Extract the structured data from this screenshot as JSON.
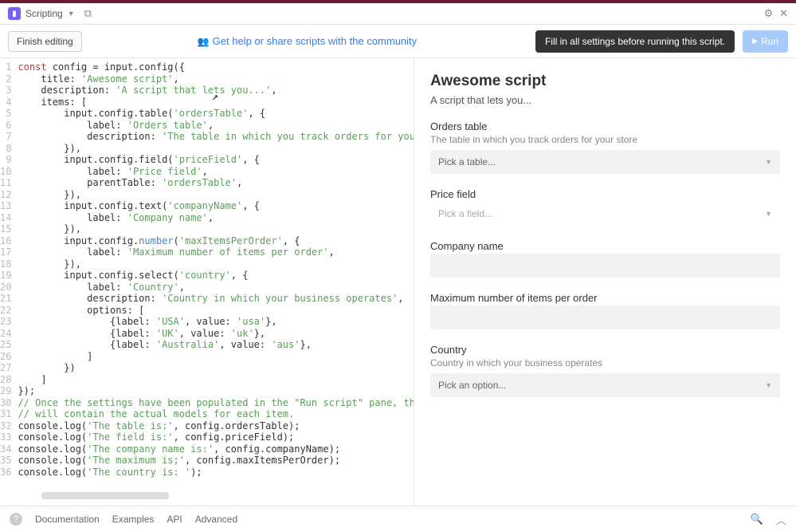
{
  "topbar": {
    "app_title": "Scripting"
  },
  "toolbar": {
    "finish_label": "Finish editing",
    "help_label": "Get help or share scripts with the community",
    "toast_text": "Fill in all settings before running this script.",
    "run_label": "Run"
  },
  "code": {
    "lines": [
      [
        [
          "kw",
          "const"
        ],
        [
          "pln",
          " config = input.config({"
        ]
      ],
      [
        [
          "pln",
          "    title: "
        ],
        [
          "str",
          "'Awesome script'"
        ],
        [
          "pln",
          ","
        ]
      ],
      [
        [
          "pln",
          "    description: "
        ],
        [
          "str",
          "'A script that le"
        ],
        [
          "cursor",
          ""
        ],
        [
          "str",
          "ts you...'"
        ],
        [
          "pln",
          ","
        ]
      ],
      [
        [
          "pln",
          "    items: ["
        ]
      ],
      [
        [
          "pln",
          "        input.config.table("
        ],
        [
          "str",
          "'ordersTable'"
        ],
        [
          "pln",
          ", {"
        ]
      ],
      [
        [
          "pln",
          "            label: "
        ],
        [
          "str",
          "'Orders table'"
        ],
        [
          "pln",
          ","
        ]
      ],
      [
        [
          "pln",
          "            description: "
        ],
        [
          "str",
          "'The table in which you track orders for your store'"
        ]
      ],
      [
        [
          "pln",
          "        }),"
        ]
      ],
      [
        [
          "pln",
          "        input.config.field("
        ],
        [
          "str",
          "'priceField'"
        ],
        [
          "pln",
          ", {"
        ]
      ],
      [
        [
          "pln",
          "            label: "
        ],
        [
          "str",
          "'Price field'"
        ],
        [
          "pln",
          ","
        ]
      ],
      [
        [
          "pln",
          "            parentTable: "
        ],
        [
          "str",
          "'ordersTable'"
        ],
        [
          "pln",
          ","
        ]
      ],
      [
        [
          "pln",
          "        }),"
        ]
      ],
      [
        [
          "pln",
          "        input.config.text("
        ],
        [
          "str",
          "'companyName'"
        ],
        [
          "pln",
          ", {"
        ]
      ],
      [
        [
          "pln",
          "            label: "
        ],
        [
          "str",
          "'Company name'"
        ],
        [
          "pln",
          ","
        ]
      ],
      [
        [
          "pln",
          "        }),"
        ]
      ],
      [
        [
          "pln",
          "        input.config."
        ],
        [
          "num",
          "number"
        ],
        [
          "pln",
          "("
        ],
        [
          "str",
          "'maxItemsPerOrder'"
        ],
        [
          "pln",
          ", {"
        ]
      ],
      [
        [
          "pln",
          "            label: "
        ],
        [
          "str",
          "'Maximum number of items per order'"
        ],
        [
          "pln",
          ","
        ]
      ],
      [
        [
          "pln",
          "        }),"
        ]
      ],
      [
        [
          "pln",
          "        input.config.select("
        ],
        [
          "str",
          "'country'"
        ],
        [
          "pln",
          ", {"
        ]
      ],
      [
        [
          "pln",
          "            label: "
        ],
        [
          "str",
          "'Country'"
        ],
        [
          "pln",
          ","
        ]
      ],
      [
        [
          "pln",
          "            description: "
        ],
        [
          "str",
          "'Country in which your business operates'"
        ],
        [
          "pln",
          ","
        ]
      ],
      [
        [
          "pln",
          "            options: ["
        ]
      ],
      [
        [
          "pln",
          "                {label: "
        ],
        [
          "str",
          "'USA'"
        ],
        [
          "pln",
          ", value: "
        ],
        [
          "str",
          "'usa'"
        ],
        [
          "pln",
          "},"
        ]
      ],
      [
        [
          "pln",
          "                {label: "
        ],
        [
          "str",
          "'UK'"
        ],
        [
          "pln",
          ", value: "
        ],
        [
          "str",
          "'uk'"
        ],
        [
          "pln",
          "},"
        ]
      ],
      [
        [
          "pln",
          "                {label: "
        ],
        [
          "str",
          "'Australia'"
        ],
        [
          "pln",
          ", value: "
        ],
        [
          "str",
          "'aus'"
        ],
        [
          "pln",
          "},"
        ]
      ],
      [
        [
          "pln",
          "            ]"
        ]
      ],
      [
        [
          "pln",
          "        })"
        ]
      ],
      [
        [
          "pln",
          "    ]"
        ]
      ],
      [
        [
          "pln",
          "});"
        ]
      ],
      [
        [
          "cmt",
          "// Once the settings have been populated in the \"Run script\" pane, the returned o"
        ]
      ],
      [
        [
          "cmt",
          "// will contain the actual models for each item."
        ]
      ],
      [
        [
          "pln",
          "console.log("
        ],
        [
          "str",
          "'The table is:'"
        ],
        [
          "pln",
          ", config.ordersTable);"
        ]
      ],
      [
        [
          "pln",
          "console.log("
        ],
        [
          "str",
          "'The field is:'"
        ],
        [
          "pln",
          ", config.priceField);"
        ]
      ],
      [
        [
          "pln",
          "console.log("
        ],
        [
          "str",
          "'The company name is:'"
        ],
        [
          "pln",
          ", config.companyName);"
        ]
      ],
      [
        [
          "pln",
          "console.log("
        ],
        [
          "str",
          "'The maximum is;'"
        ],
        [
          "pln",
          ", config.maxItemsPerOrder);"
        ]
      ],
      [
        [
          "pln",
          "console.log("
        ],
        [
          "str",
          "'The country is: '"
        ],
        [
          "pln",
          ");"
        ]
      ]
    ]
  },
  "side": {
    "title": "Awesome script",
    "desc": "A script that lets you...",
    "fields": [
      {
        "label": "Orders table",
        "desc": "The table in which you track orders for your store",
        "type": "select",
        "placeholder": "Pick a table..."
      },
      {
        "label": "Price field",
        "desc": "",
        "type": "ghost-select",
        "placeholder": "Pick a field..."
      },
      {
        "label": "Company name",
        "desc": "",
        "type": "text",
        "placeholder": ""
      },
      {
        "label": "Maximum number of items per order",
        "desc": "",
        "type": "text",
        "placeholder": ""
      },
      {
        "label": "Country",
        "desc": "Country in which your business operates",
        "type": "select",
        "placeholder": "Pick an option..."
      }
    ]
  },
  "bottombar": {
    "doc": "Documentation",
    "examples": "Examples",
    "api": "API",
    "advanced": "Advanced"
  }
}
